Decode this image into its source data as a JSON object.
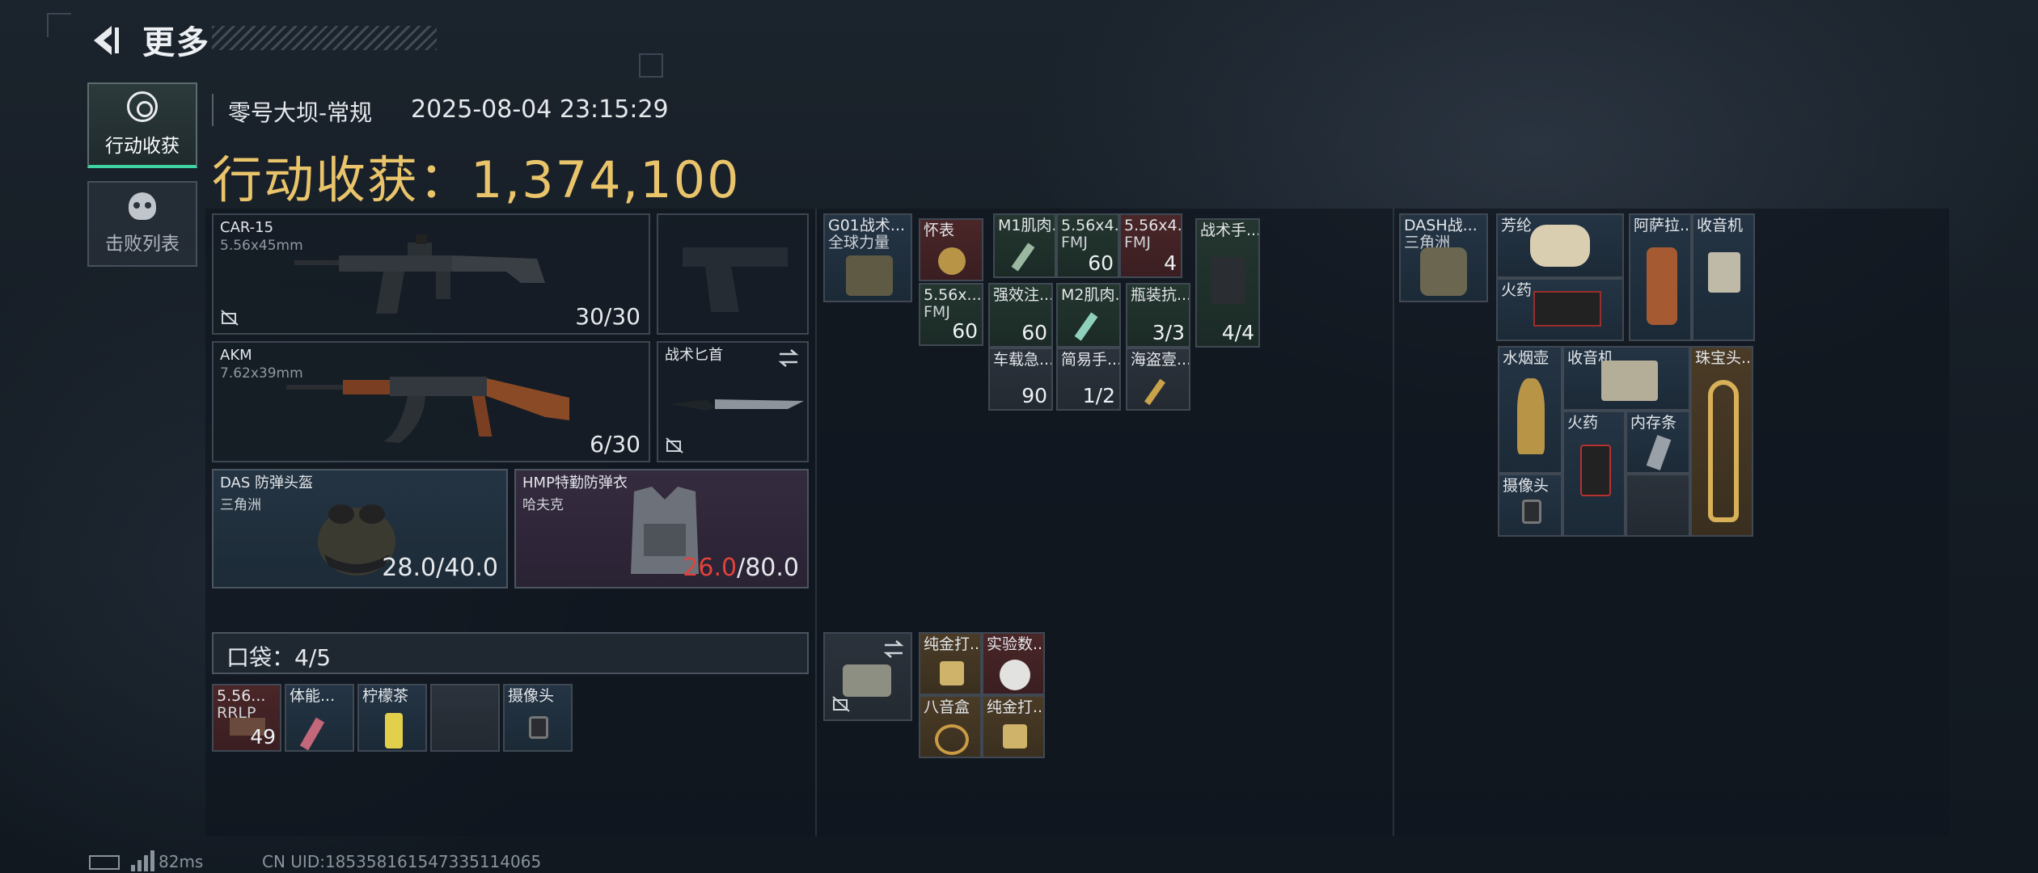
{
  "header": {
    "title": "更多",
    "back_icon": "back-arrow-icon"
  },
  "sidebar": {
    "tabs": [
      {
        "label": "行动收获",
        "icon": "target-circle-icon",
        "active": true
      },
      {
        "label": "击败列表",
        "icon": "skull-icon",
        "active": false
      }
    ]
  },
  "match": {
    "map": "零号大坝-常规",
    "datetime": "2025-08-04 23:15:29",
    "earnings_label": "行动收获：",
    "earnings_value": "1,374,100"
  },
  "loadout": {
    "primary": {
      "name": "CAR-15",
      "ammo": "5.56x45mm",
      "count": "30/30"
    },
    "pistol": {
      "name": ""
    },
    "secondary": {
      "name": "AKM",
      "ammo": "7.62x39mm",
      "count": "6/30"
    },
    "melee": {
      "name": "战术匕首"
    },
    "helmet": {
      "name": "DAS 防弹头盔",
      "brand": "三角洲",
      "current": "28.0",
      "max": "/40.0"
    },
    "armor": {
      "name": "HMP特勤防弹衣",
      "brand": "哈夫克",
      "current": "26.0",
      "max": "/80.0"
    }
  },
  "chest_rig": {
    "name": "G01战术...",
    "sub": "全球力量",
    "items": [
      {
        "name": "怀表"
      },
      {
        "name": "5.56x...",
        "sub": "FMJ",
        "count": "60"
      },
      {
        "name": "M1肌肉..."
      },
      {
        "name": "5.56x4...",
        "sub": "FMJ",
        "count": "60"
      },
      {
        "name": "5.56x4...",
        "sub": "FMJ",
        "count": "4"
      },
      {
        "name": "战术手...",
        "count": "4/4"
      },
      {
        "name": "强效注...",
        "count": "60"
      },
      {
        "name": "M2肌肉..."
      },
      {
        "name": "瓶装抗...",
        "count": "3/3"
      },
      {
        "name": "车载急...",
        "count": "90"
      },
      {
        "name": "简易手...",
        "count": "1/2"
      },
      {
        "name": "海盗壹..."
      }
    ]
  },
  "pouch": {
    "items": [
      {
        "name": "纯金打..."
      },
      {
        "name": "实验数..."
      },
      {
        "name": "八音盒"
      },
      {
        "name": "纯金打..."
      }
    ]
  },
  "backpack": {
    "name": "DASH战...",
    "sub": "三角洲",
    "items": [
      {
        "name": "芳纶"
      },
      {
        "name": "火药"
      },
      {
        "name": "阿萨拉..."
      },
      {
        "name": "收音机"
      },
      {
        "name": "水烟壶"
      },
      {
        "name": "收音机"
      },
      {
        "name": "珠宝头..."
      },
      {
        "name": "火药"
      },
      {
        "name": "内存条"
      },
      {
        "name": "摄像头"
      }
    ]
  },
  "pockets": {
    "label": "口袋：4/5",
    "items": [
      {
        "name": "5.56...",
        "sub": "RRLP",
        "count": "49"
      },
      {
        "name": "体能..."
      },
      {
        "name": "柠檬茶"
      },
      {
        "name": ""
      },
      {
        "name": "摄像头"
      }
    ]
  },
  "status": {
    "ping": "82ms",
    "uid": "CN UID:185358161547335114065"
  },
  "colors": {
    "gold": "#e9c46a",
    "accent_green": "#3fd3a2",
    "damage_red": "#e2423a"
  }
}
